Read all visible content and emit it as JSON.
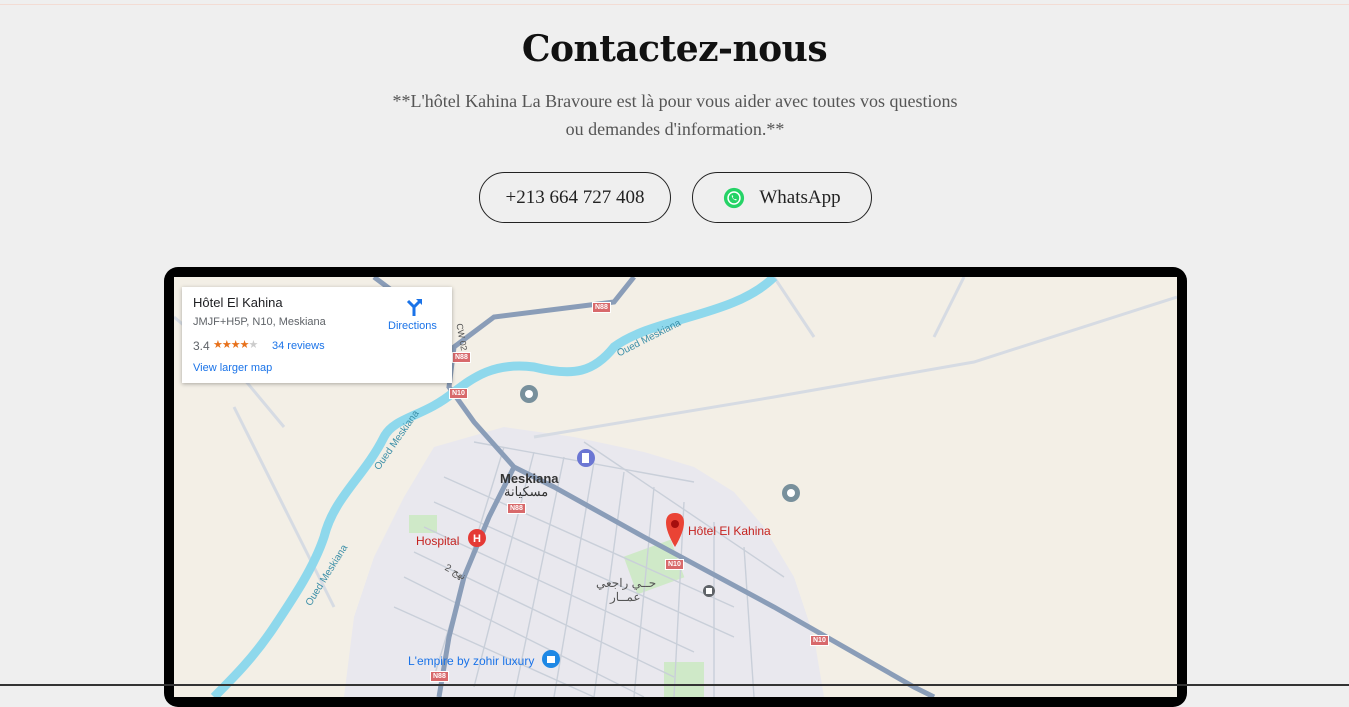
{
  "contact": {
    "title": "Contactez-nous",
    "subtitle": "**L'hôtel Kahina La Bravoure est là pour vous aider avec toutes vos questions ou demandes d'information.**",
    "phone_label": "+213 664 727 408",
    "whatsapp_label": "WhatsApp",
    "whatsapp_icon": "whatsapp-icon",
    "colors": {
      "whatsapp_green": "#25d366",
      "pin_red": "#ea4335",
      "river_blue": "#8ed8ec",
      "link_blue": "#1a73e8"
    }
  },
  "map": {
    "card": {
      "place_name": "Hôtel El Kahina",
      "address": "JMJF+H5P, N10, Meskiana",
      "rating": "3.4",
      "stars_filled": "★★★★",
      "stars_empty": "★",
      "reviews_link": "34 reviews",
      "larger_map_link": "View larger map",
      "directions_label": "Directions",
      "directions_icon": "directions-icon"
    },
    "labels": {
      "town": "Meskiana",
      "town_arabic": "مسكيانة",
      "hotel": "Hôtel El Kahina",
      "hospital": "Hospital",
      "district_line1": "حــي راجعي",
      "district_line2": "عمــار",
      "river_1": "Oued Meskiana",
      "river_2": "Oued Meskiana",
      "river_3": "Oued Meskiana",
      "cw_road": "CW 02",
      "street": "نهج 2",
      "business": "L'empire by zohir luxury"
    },
    "road_shields": {
      "n88_a": "N88",
      "n88_b": "N88",
      "n88_c": "N88",
      "n88_d": "N88",
      "n10_a": "N10",
      "n10_b": "N10",
      "n10_c": "N10"
    }
  }
}
